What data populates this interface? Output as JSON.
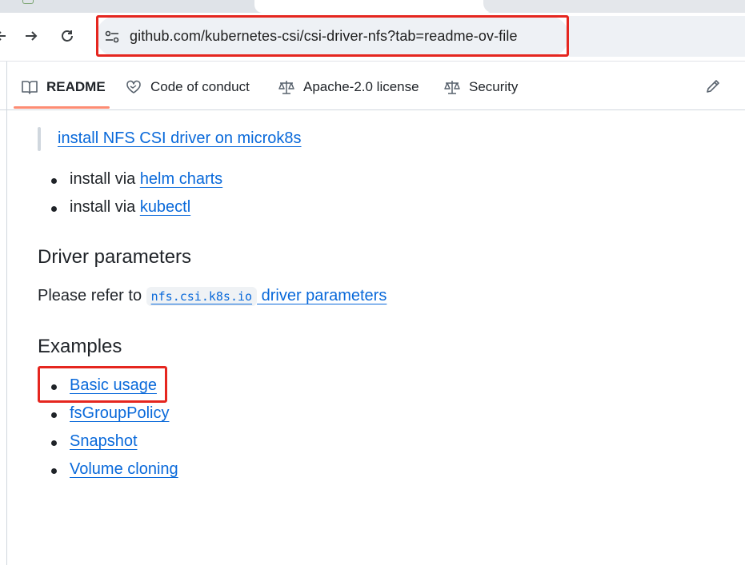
{
  "browser": {
    "tab_active_title": "",
    "url": "github.com/kubernetes-csi/csi-driver-nfs?tab=readme-ov-file"
  },
  "readme_nav": {
    "tabs": [
      {
        "label": "README",
        "icon": "book-icon",
        "active": true
      },
      {
        "label": "Code of conduct",
        "icon": "heart-handshake-icon",
        "active": false
      },
      {
        "label": "Apache-2.0 license",
        "icon": "scale-icon",
        "active": false
      },
      {
        "label": "Security",
        "icon": "scale-icon",
        "active": false
      }
    ],
    "edit_icon": "pencil-icon"
  },
  "content": {
    "blockquote_link": "install NFS CSI driver on microk8s",
    "install_items": [
      {
        "prefix": "install via ",
        "link": "helm charts"
      },
      {
        "prefix": "install via ",
        "link": "kubectl"
      }
    ],
    "driver_params": {
      "heading": "Driver parameters",
      "prefix": "Please refer to ",
      "code": "nfs.csi.k8s.io",
      "link": " driver parameters"
    },
    "examples": {
      "heading": "Examples",
      "items": [
        "Basic usage",
        "fsGroupPolicy",
        "Snapshot",
        "Volume cloning"
      ]
    }
  },
  "colors": {
    "link": "#0969da",
    "highlight": "#e5261f",
    "tab_underline": "#fd8c73"
  }
}
